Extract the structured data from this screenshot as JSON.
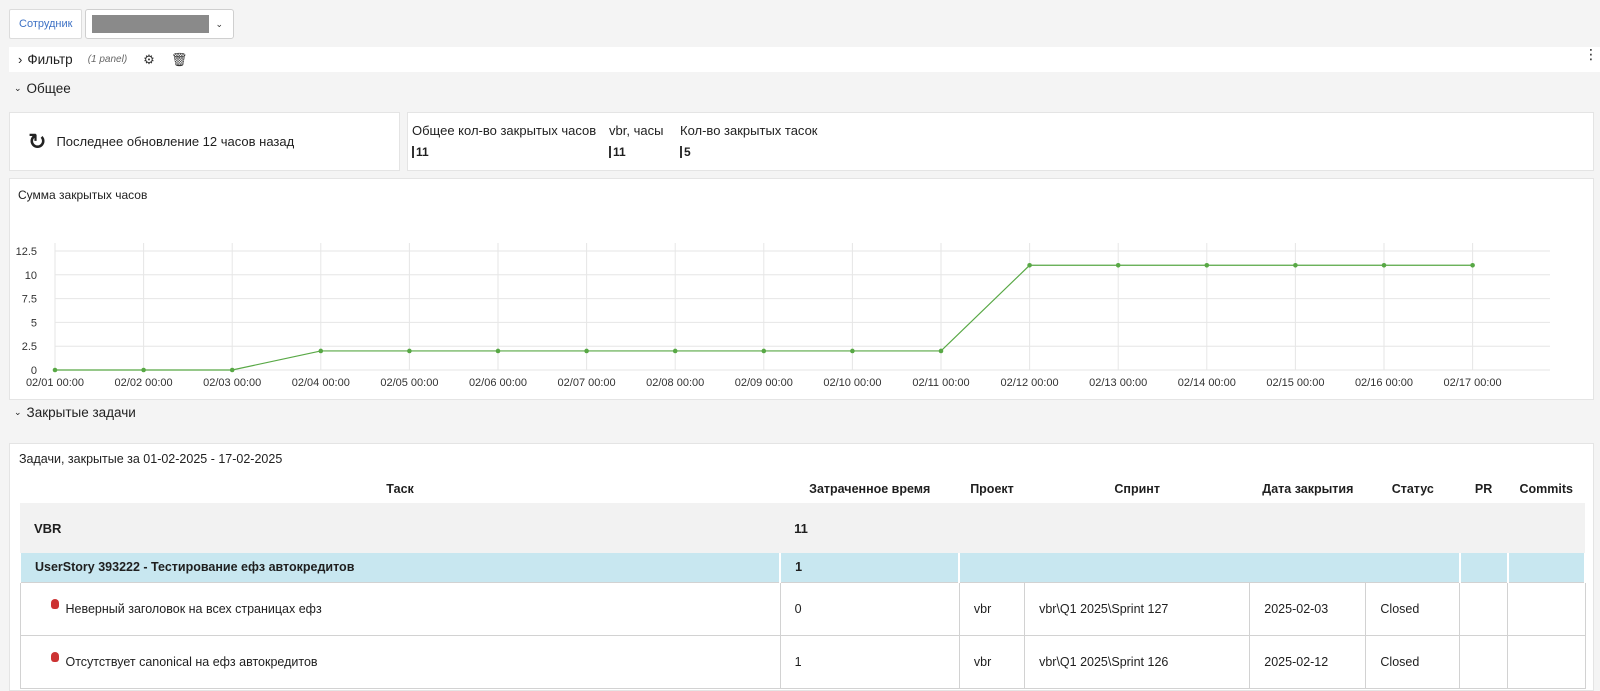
{
  "topbar": {
    "employee_label": "Сотрудник",
    "employee_value": ""
  },
  "filter": {
    "title": "Фильтр",
    "panels": "(1 panel)"
  },
  "sections": {
    "general": "Общее",
    "closed_tasks": "Закрытые задачи"
  },
  "update": {
    "text": "Последнее обновление 12 часов назад"
  },
  "stats": [
    {
      "label": "Общее кол-во закрытых часов",
      "value": "11"
    },
    {
      "label": "vbr, часы",
      "value": "11"
    },
    {
      "label": "Кол-во закрытых тасок",
      "value": "5"
    }
  ],
  "chart_title": "Сумма закрытых часов",
  "chart_data": {
    "type": "line",
    "title": "Сумма закрытых часов",
    "x": [
      "02/01 00:00",
      "02/02 00:00",
      "02/03 00:00",
      "02/04 00:00",
      "02/05 00:00",
      "02/06 00:00",
      "02/07 00:00",
      "02/08 00:00",
      "02/09 00:00",
      "02/10 00:00",
      "02/11 00:00",
      "02/12 00:00",
      "02/13 00:00",
      "02/14 00:00",
      "02/15 00:00",
      "02/16 00:00",
      "02/17 00:00"
    ],
    "series": [
      {
        "values": [
          0,
          0,
          0,
          2,
          2,
          2,
          2,
          2,
          2,
          2,
          2,
          11,
          11,
          11,
          11,
          11,
          11
        ]
      }
    ],
    "y_ticks": [
      "0",
      "2.5",
      "5",
      "7.5",
      "10",
      "12.5"
    ],
    "ylim": [
      0,
      12.5
    ],
    "grid": true,
    "line_color": "#58a845"
  },
  "tasks": {
    "title": "Задачи, закрытые за 01-02-2025 - 17-02-2025",
    "columns": [
      "Таск",
      "Затраченное время",
      "Проект",
      "Спринт",
      "Дата закрытия",
      "Статус",
      "PR",
      "Commits"
    ],
    "group": {
      "name": "VBR",
      "time": "11"
    },
    "story": {
      "name": "UserStory 393222 - Тестирование ефз автокредитов",
      "time": "1"
    },
    "rows": [
      {
        "task": "Неверный заголовок на всех страницах ефз",
        "time": "0",
        "project": "vbr",
        "sprint": "vbr\\Q1 2025\\Sprint 127",
        "date": "2025-02-03",
        "status": "Closed",
        "pr": "",
        "commits": ""
      },
      {
        "task": "Отсутствует canonical на ефз автокредитов",
        "time": "1",
        "project": "vbr",
        "sprint": "vbr\\Q1 2025\\Sprint 126",
        "date": "2025-02-12",
        "status": "Closed",
        "pr": "",
        "commits": ""
      }
    ]
  }
}
